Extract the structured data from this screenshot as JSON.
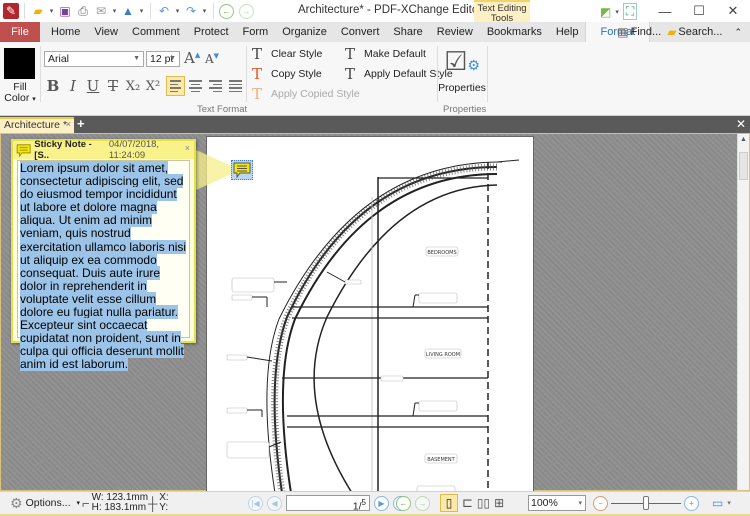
{
  "window": {
    "title": "Architecture* - PDF-XChange Editor",
    "context_tab_header": "Text Editing Tools",
    "controls": [
      "minimize",
      "maximize",
      "close"
    ]
  },
  "quick_access": {
    "icons": [
      "app-logo-icon",
      "open-folder-icon",
      "save-icon",
      "print-icon",
      "email-icon",
      "scan-icon",
      "undo-icon",
      "redo-icon",
      "back-icon",
      "forward-icon"
    ]
  },
  "menu": {
    "file": "File",
    "items": [
      "Home",
      "View",
      "Comment",
      "Protect",
      "Form",
      "Organize",
      "Convert",
      "Share",
      "Review",
      "Bookmarks",
      "Help"
    ],
    "active_tab": "Format",
    "find": "Find...",
    "search": "Search..."
  },
  "ribbon": {
    "fill_color_label": "Fill Color",
    "fill_color_value": "#000000",
    "font": "Arial",
    "font_size": "12 pt",
    "format_buttons": [
      "B",
      "I",
      "U",
      "T",
      "X₂",
      "X²"
    ],
    "text_format_label": "Text Format",
    "clear_style": "Clear Style",
    "copy_style": "Copy Style",
    "apply_copied_style": "Apply Copied Style",
    "make_default": "Make Default",
    "apply_default_style": "Apply Default Style",
    "properties": "Properties",
    "properties_group_label": "Properties"
  },
  "doc_tabs": {
    "tabs": [
      {
        "label": "Architecture *"
      }
    ]
  },
  "sticky_note": {
    "title": "Sticky Note - [S..",
    "datetime": "04/07/2018, 11:24:09",
    "text": "Lorem ipsum dolor sit amet, consectetur adipiscing elit, sed do eiusmod tempor incididunt ut labore et dolore magna aliqua. Ut enim ad minim veniam, quis nostrud exercitation ullamco laboris nisi ut aliquip ex ea commodo consequat. Duis aute irure dolor in reprehenderit in voluptate velit esse cillum dolore eu fugiat nulla pariatur. Excepteur sint occaecat cupidatat non proident, sunt in culpa qui officia deserunt mollit anim id est laborum."
  },
  "drawing": {
    "labels": [
      "BEDROOMS",
      "LIVING ROOM",
      "BASEMENT"
    ]
  },
  "statusbar": {
    "options": "Options...",
    "width": "W: 123.1mm",
    "height": "H: 183.1mm",
    "x": "X:",
    "y": "Y:",
    "page_current": "1",
    "page_total": "5",
    "page_display": "1/5",
    "zoom": "100%"
  },
  "colors": {
    "file_tab": "#c0504d",
    "accent": "#2a6ebb",
    "highlight": "#fde9a8",
    "note_border": "#e4df4a",
    "selection": "#9cc4e8"
  }
}
